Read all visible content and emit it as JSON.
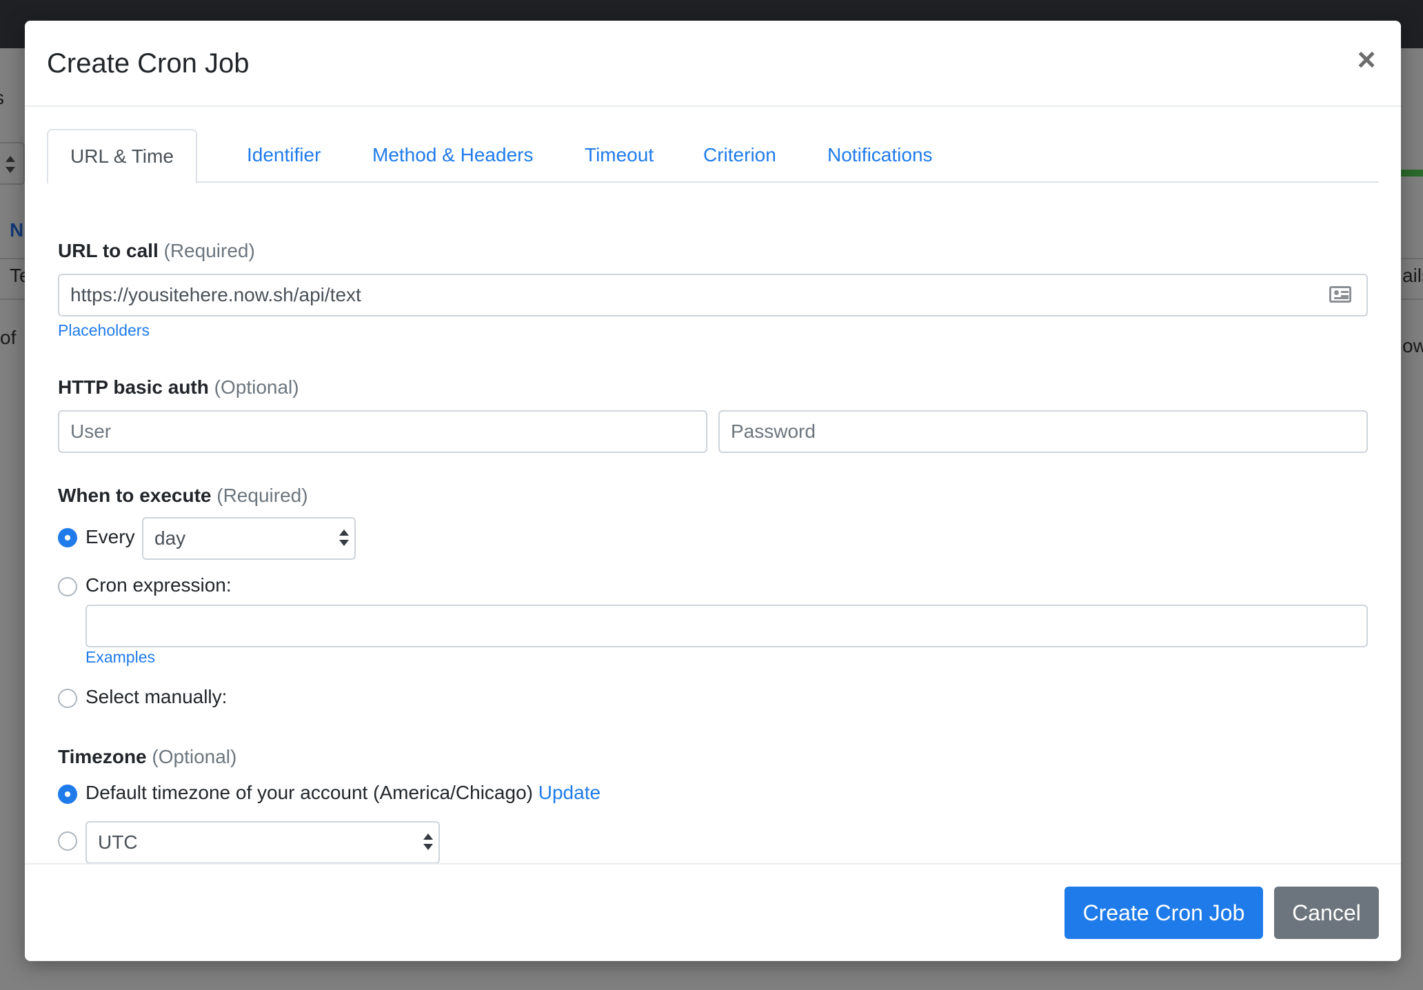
{
  "background": {
    "fragments": [
      "s",
      "N",
      "Te",
      "of",
      "ails",
      "ow"
    ]
  },
  "modal": {
    "title": "Create Cron Job",
    "close_symbol": "×",
    "tabs": [
      {
        "label": "URL & Time",
        "active": true
      },
      {
        "label": "Identifier",
        "active": false
      },
      {
        "label": "Method & Headers",
        "active": false
      },
      {
        "label": "Timeout",
        "active": false
      },
      {
        "label": "Criterion",
        "active": false
      },
      {
        "label": "Notifications",
        "active": false
      }
    ],
    "url": {
      "label": "URL to call",
      "hint": "(Required)",
      "value": "https://yousitehere.now.sh/api/text",
      "icon": "address-card-icon",
      "placeholders_link": "Placeholders"
    },
    "auth": {
      "label": "HTTP basic auth",
      "hint": "(Optional)",
      "user_placeholder": "User",
      "password_placeholder": "Password"
    },
    "execute": {
      "label": "When to execute",
      "hint": "(Required)",
      "every_label": "Every",
      "every_value": "day",
      "cron_label": "Cron expression:",
      "cron_value": "",
      "examples_link": "Examples",
      "manual_label": "Select manually:",
      "selected": "every"
    },
    "timezone": {
      "label": "Timezone",
      "hint": "(Optional)",
      "default_label": "Default timezone of your account (America/Chicago)",
      "update_link": "Update",
      "custom_value": "UTC",
      "selected": "default"
    },
    "footer": {
      "create_label": "Create Cron Job",
      "cancel_label": "Cancel"
    },
    "colors": {
      "primary": "#1f7bea",
      "secondary": "#6c757d"
    }
  }
}
